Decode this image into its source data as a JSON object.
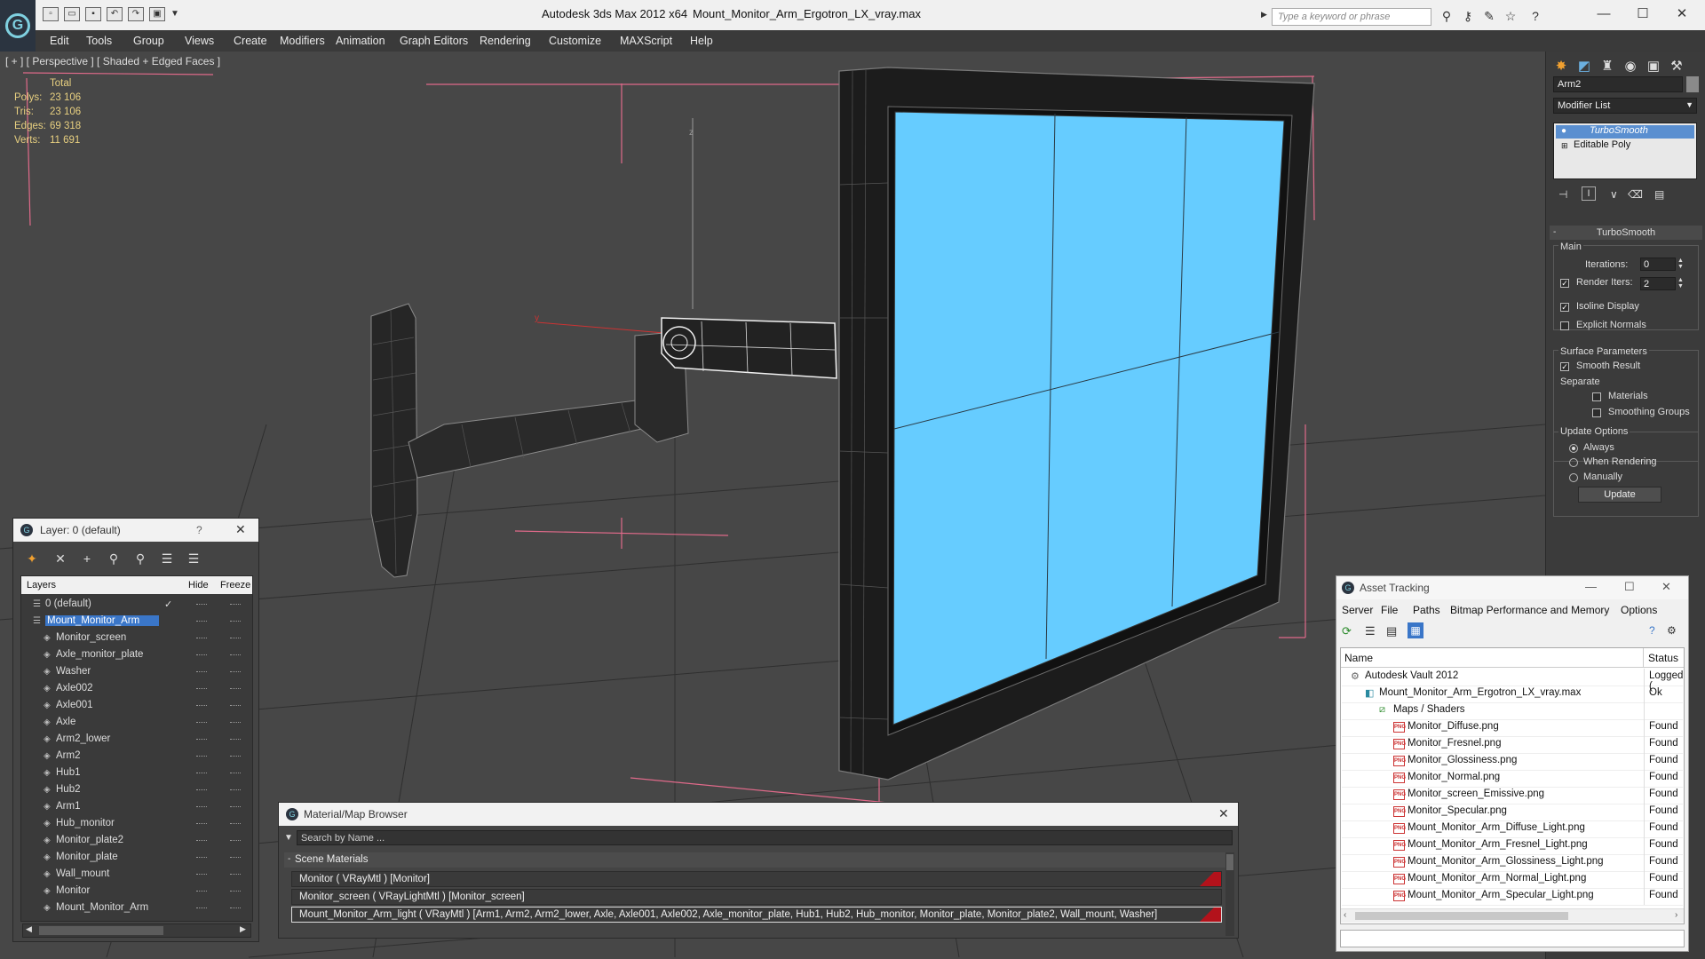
{
  "window": {
    "app_title": "Autodesk 3ds Max  2012 x64",
    "file_title": "Mount_Monitor_Arm_Ergotron_LX_vray.max",
    "search_placeholder": "Type a keyword or phrase"
  },
  "menu": [
    "Edit",
    "Tools",
    "Group",
    "Views",
    "Create",
    "Modifiers",
    "Animation",
    "Graph Editors",
    "Rendering",
    "Customize",
    "MAXScript",
    "Help"
  ],
  "viewport": {
    "label": "[ + ] [ Perspective ] [ Shaded + Edged Faces ]",
    "stats": {
      "header": "Total",
      "rows": [
        {
          "label": "Polys:",
          "value": "23 106"
        },
        {
          "label": "Tris:",
          "value": "23 106"
        },
        {
          "label": "Edges:",
          "value": "69 318"
        },
        {
          "label": "Verts:",
          "value": "11 691"
        }
      ]
    },
    "screen_color": "#66ccff"
  },
  "command_panel": {
    "object_name": "Arm2",
    "modifier_list": "Modifier List",
    "stack": [
      "TurboSmooth",
      "Editable Poly"
    ],
    "rollout_title": "TurboSmooth",
    "main_label": "Main",
    "iterations_label": "Iterations:",
    "iterations_value": "0",
    "render_iters_label": "Render Iters:",
    "render_iters_value": "2",
    "isoline_label": "Isoline Display",
    "explicit_normals_label": "Explicit Normals",
    "surface_params_label": "Surface Parameters",
    "smooth_result_label": "Smooth Result",
    "separate_label": "Separate",
    "materials_label": "Materials",
    "smoothing_groups_label": "Smoothing Groups",
    "update_options_label": "Update Options",
    "always_label": "Always",
    "when_rendering_label": "When Rendering",
    "manually_label": "Manually",
    "update_button": "Update"
  },
  "layer_dialog": {
    "title": "Layer: 0 (default)",
    "help": "?",
    "col_layers": "Layers",
    "col_hide": "Hide",
    "col_freeze": "Freeze",
    "rows": [
      {
        "name": "0 (default)",
        "level": 0
      },
      {
        "name": "Mount_Monitor_Arm",
        "level": 0,
        "selected": true
      },
      {
        "name": "Monitor_screen",
        "level": 1
      },
      {
        "name": "Axle_monitor_plate",
        "level": 1
      },
      {
        "name": "Washer",
        "level": 1
      },
      {
        "name": "Axle002",
        "level": 1
      },
      {
        "name": "Axle001",
        "level": 1
      },
      {
        "name": "Axle",
        "level": 1
      },
      {
        "name": "Arm2_lower",
        "level": 1
      },
      {
        "name": "Arm2",
        "level": 1
      },
      {
        "name": "Hub1",
        "level": 1
      },
      {
        "name": "Hub2",
        "level": 1
      },
      {
        "name": "Arm1",
        "level": 1
      },
      {
        "name": "Hub_monitor",
        "level": 1
      },
      {
        "name": "Monitor_plate2",
        "level": 1
      },
      {
        "name": "Monitor_plate",
        "level": 1
      },
      {
        "name": "Wall_mount",
        "level": 1
      },
      {
        "name": "Monitor",
        "level": 1
      },
      {
        "name": "Mount_Monitor_Arm",
        "level": 1
      }
    ]
  },
  "material_browser": {
    "title": "Material/Map Browser",
    "search_placeholder": "Search by Name ...",
    "section": "Scene Materials",
    "rows": [
      "Monitor  ( VRayMtl )  [Monitor]",
      "Monitor_screen  ( VRayLightMtl )  [Monitor_screen]",
      "Mount_Monitor_Arm_light  ( VRayMtl )  [Arm1, Arm2, Arm2_lower, Axle, Axle001, Axle002, Axle_monitor_plate, Hub1, Hub2, Hub_monitor, Monitor_plate, Monitor_plate2, Wall_mount, Washer]"
    ]
  },
  "asset_tracking": {
    "title": "Asset Tracking",
    "menu": [
      "Server",
      "File",
      "Paths",
      "Bitmap Performance and Memory",
      "Options"
    ],
    "col_name": "Name",
    "col_status": "Status",
    "rows": [
      {
        "name": "Autodesk Vault 2012",
        "status": "Logged (",
        "level": 0,
        "type": "vault"
      },
      {
        "name": "Mount_Monitor_Arm_Ergotron_LX_vray.max",
        "status": "Ok",
        "level": 1,
        "type": "max"
      },
      {
        "name": "Maps / Shaders",
        "status": "",
        "level": 2,
        "type": "maps"
      },
      {
        "name": "Monitor_Diffuse.png",
        "status": "Found",
        "level": 3,
        "type": "png"
      },
      {
        "name": "Monitor_Fresnel.png",
        "status": "Found",
        "level": 3,
        "type": "png"
      },
      {
        "name": "Monitor_Glossiness.png",
        "status": "Found",
        "level": 3,
        "type": "png"
      },
      {
        "name": "Monitor_Normal.png",
        "status": "Found",
        "level": 3,
        "type": "png"
      },
      {
        "name": "Monitor_screen_Emissive.png",
        "status": "Found",
        "level": 3,
        "type": "png"
      },
      {
        "name": "Monitor_Specular.png",
        "status": "Found",
        "level": 3,
        "type": "png"
      },
      {
        "name": "Mount_Monitor_Arm_Diffuse_Light.png",
        "status": "Found",
        "level": 3,
        "type": "png"
      },
      {
        "name": "Mount_Monitor_Arm_Fresnel_Light.png",
        "status": "Found",
        "level": 3,
        "type": "png"
      },
      {
        "name": "Mount_Monitor_Arm_Glossiness_Light.png",
        "status": "Found",
        "level": 3,
        "type": "png"
      },
      {
        "name": "Mount_Monitor_Arm_Normal_Light.png",
        "status": "Found",
        "level": 3,
        "type": "png"
      },
      {
        "name": "Mount_Monitor_Arm_Specular_Light.png",
        "status": "Found",
        "level": 3,
        "type": "png"
      }
    ]
  }
}
